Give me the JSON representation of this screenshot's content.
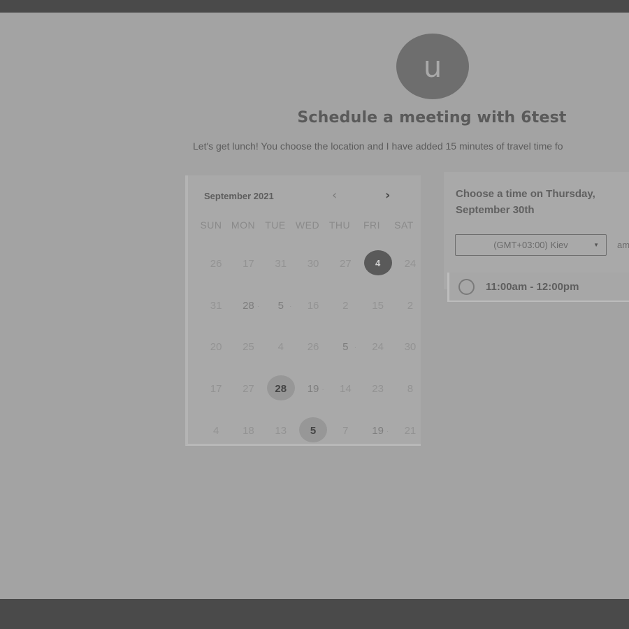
{
  "profile": {
    "avatar_letter": "u"
  },
  "header": {
    "title": "Schedule a meeting with 6test",
    "subtitle": "Let's get lunch! You choose the location and I have added 15 minutes of travel time fo"
  },
  "calendar": {
    "month_label": "September 2021",
    "prev_icon": "‹",
    "next_icon": "›",
    "weekdays": [
      "SUN",
      "MON",
      "TUE",
      "WED",
      "THU",
      "FRI",
      "SAT"
    ],
    "days": [
      "26",
      "17",
      "31",
      "30",
      "27",
      "4",
      "24",
      "31",
      "28",
      "5",
      "16",
      "2",
      "15",
      "2",
      "20",
      "25",
      "4",
      "26",
      "5",
      "24",
      "30",
      "17",
      "27",
      "28",
      "19",
      "14",
      "23",
      "8",
      "4",
      "18",
      "13",
      "5",
      "7",
      "19",
      "21"
    ],
    "selected_day": "4",
    "highlighted_days": [
      "28",
      "5"
    ]
  },
  "times": {
    "heading": "Choose a time on Thursday, September 30th",
    "timezone": "(GMT+03:00) Kiev",
    "format_label": "am",
    "slot_label": "11:00am - 12:00pm"
  }
}
